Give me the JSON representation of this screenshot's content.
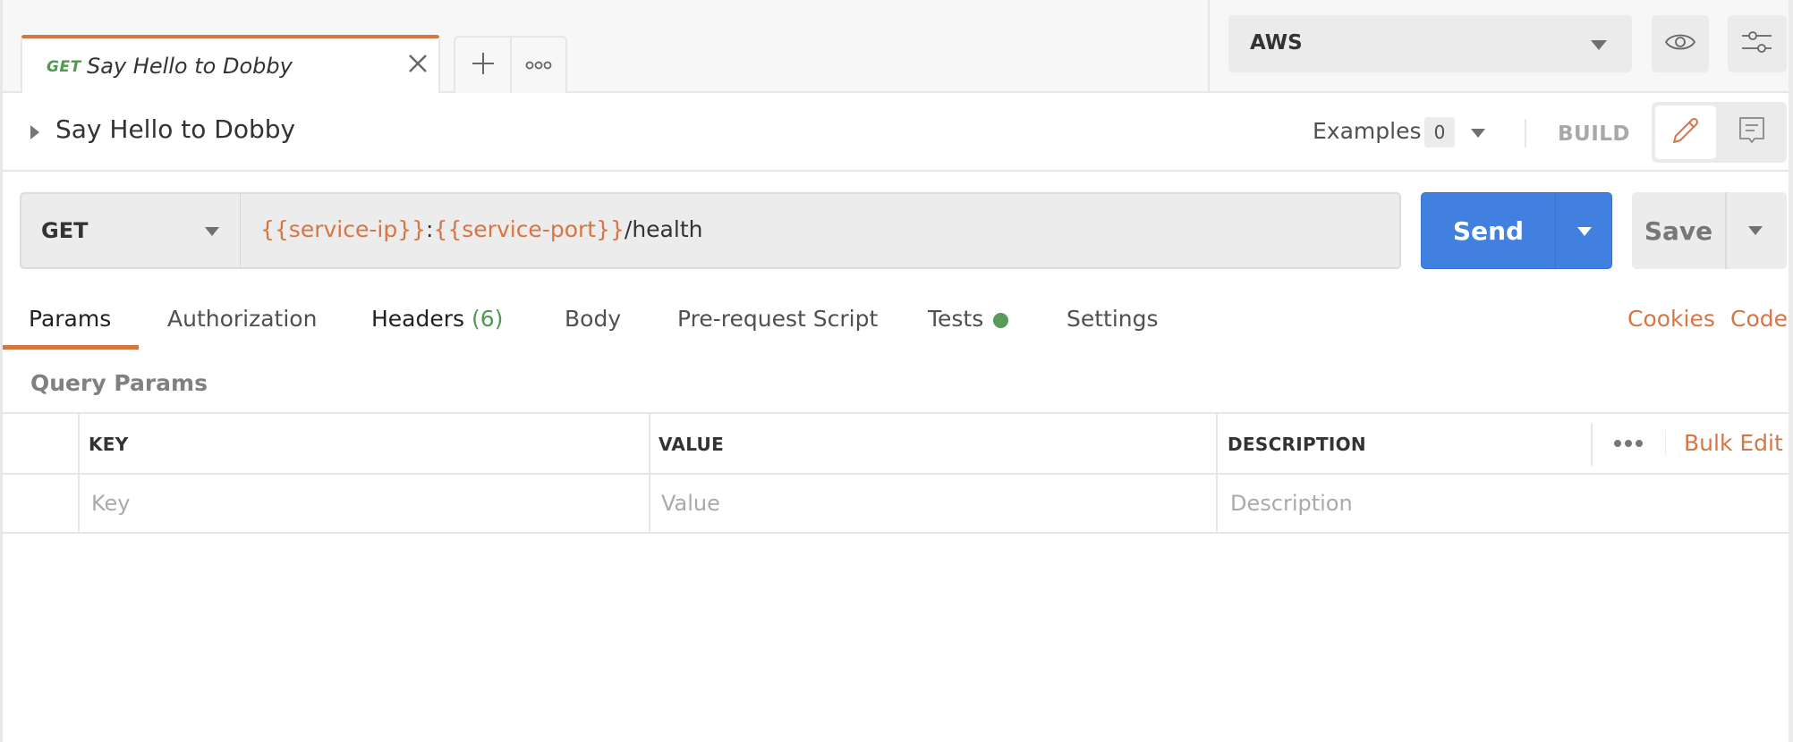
{
  "tabbar": {
    "active_tab": {
      "method": "GET",
      "name": "Say Hello to Dobby",
      "method_color": "#4e9a4e",
      "accent_color": "#d67645"
    },
    "new_tab_icon": "plus-icon",
    "more_tabs_icon": "more-horizontal-icon"
  },
  "environment": {
    "selected": "AWS",
    "quick_look_icon": "eye-icon",
    "manage_icon": "sliders-icon"
  },
  "request_header": {
    "title": "Say Hello to Dobby",
    "examples_label": "Examples",
    "examples_count": "0",
    "build_label": "BUILD",
    "modes": [
      {
        "icon": "pencil-icon",
        "active": true
      },
      {
        "icon": "comment-icon",
        "active": false
      }
    ]
  },
  "url_bar": {
    "method": "GET",
    "url_parts": [
      {
        "text": "{{service-ip}}",
        "type": "variable"
      },
      {
        "text": ":",
        "type": "plain"
      },
      {
        "text": "{{service-port}}",
        "type": "variable"
      },
      {
        "text": "/health",
        "type": "plain"
      }
    ],
    "send_label": "Send",
    "save_label": "Save",
    "send_color": "#4280e0"
  },
  "subtabs": {
    "items": [
      {
        "label": "Params",
        "active": true
      },
      {
        "label": "Authorization",
        "active": false
      },
      {
        "label": "Headers",
        "count": "(6)",
        "active": false
      },
      {
        "label": "Body",
        "active": false
      },
      {
        "label": "Pre-request Script",
        "active": false
      },
      {
        "label": "Tests",
        "indicator": "green-dot",
        "active": false
      },
      {
        "label": "Settings",
        "active": false
      }
    ],
    "links": [
      "Cookies",
      "Code"
    ]
  },
  "query_params": {
    "title": "Query Params",
    "columns": [
      "KEY",
      "VALUE",
      "DESCRIPTION"
    ],
    "placeholders": [
      "Key",
      "Value",
      "Description"
    ],
    "bulk_edit_label": "Bulk Edit"
  }
}
